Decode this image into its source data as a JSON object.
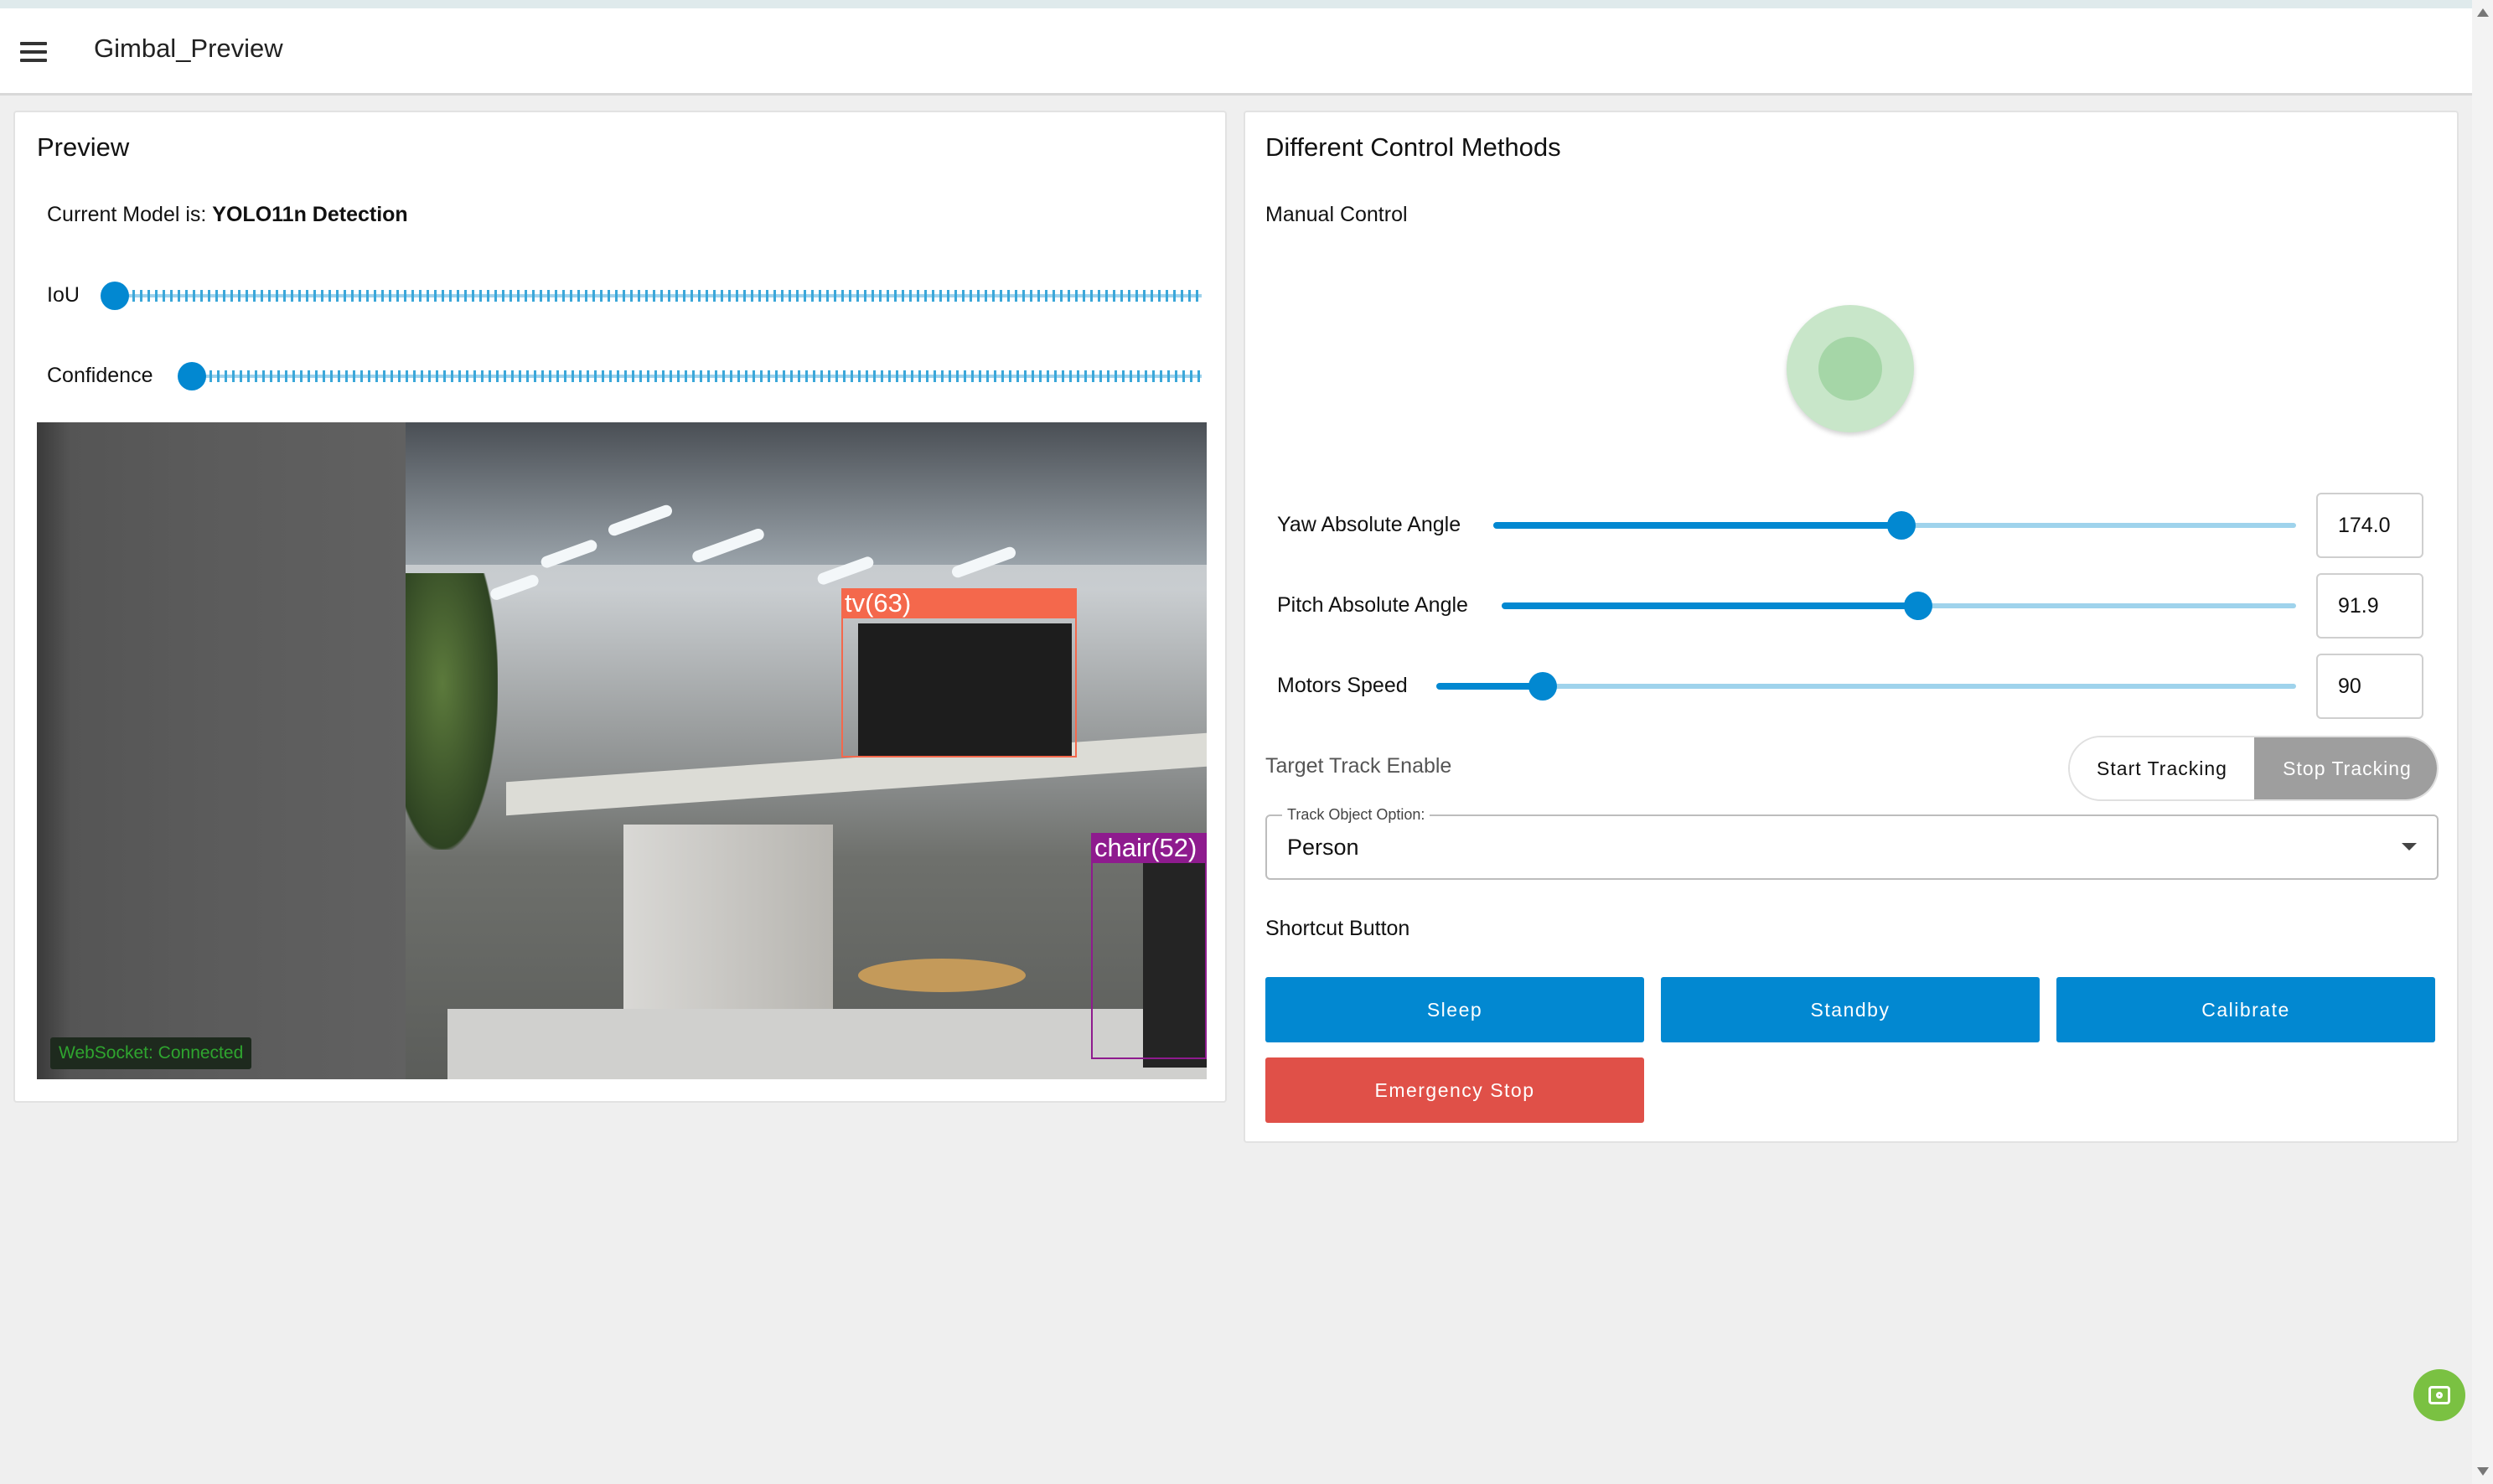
{
  "app": {
    "title": "Gimbal_Preview"
  },
  "preview": {
    "title": "Preview",
    "model_prefix": "Current Model is: ",
    "model_name": "YOLO11n Detection",
    "iou_label": "IoU",
    "confidence_label": "Confidence",
    "detections": [
      {
        "label": "tv(63)",
        "color": "#f4684c"
      },
      {
        "label": "chair(52)",
        "color": "#8e1b8e"
      }
    ],
    "websocket_status": "WebSocket: Connected"
  },
  "control": {
    "title": "Different Control Methods",
    "manual_label": "Manual Control",
    "sliders": [
      {
        "label": "Yaw Absolute Angle",
        "value": "174.0"
      },
      {
        "label": "Pitch Absolute Angle",
        "value": "91.9"
      },
      {
        "label": "Motors Speed",
        "value": "90"
      }
    ],
    "track_enable_label": "Target Track Enable",
    "start_tracking": "Start Tracking",
    "stop_tracking": "Stop Tracking",
    "track_option_legend": "Track Object Option:",
    "track_option_value": "Person",
    "shortcut_label": "Shortcut Button",
    "buttons": {
      "sleep": "Sleep",
      "standby": "Standby",
      "calibrate": "Calibrate",
      "emergency": "Emergency Stop"
    }
  },
  "colors": {
    "accent": "#0288d1",
    "danger": "#e05048",
    "joystick": "#c8e6c9",
    "fab": "#7ac142"
  },
  "icons": {
    "menu": "menu-icon",
    "dropdown": "chevron-down-icon",
    "fab": "screenshot-icon"
  }
}
